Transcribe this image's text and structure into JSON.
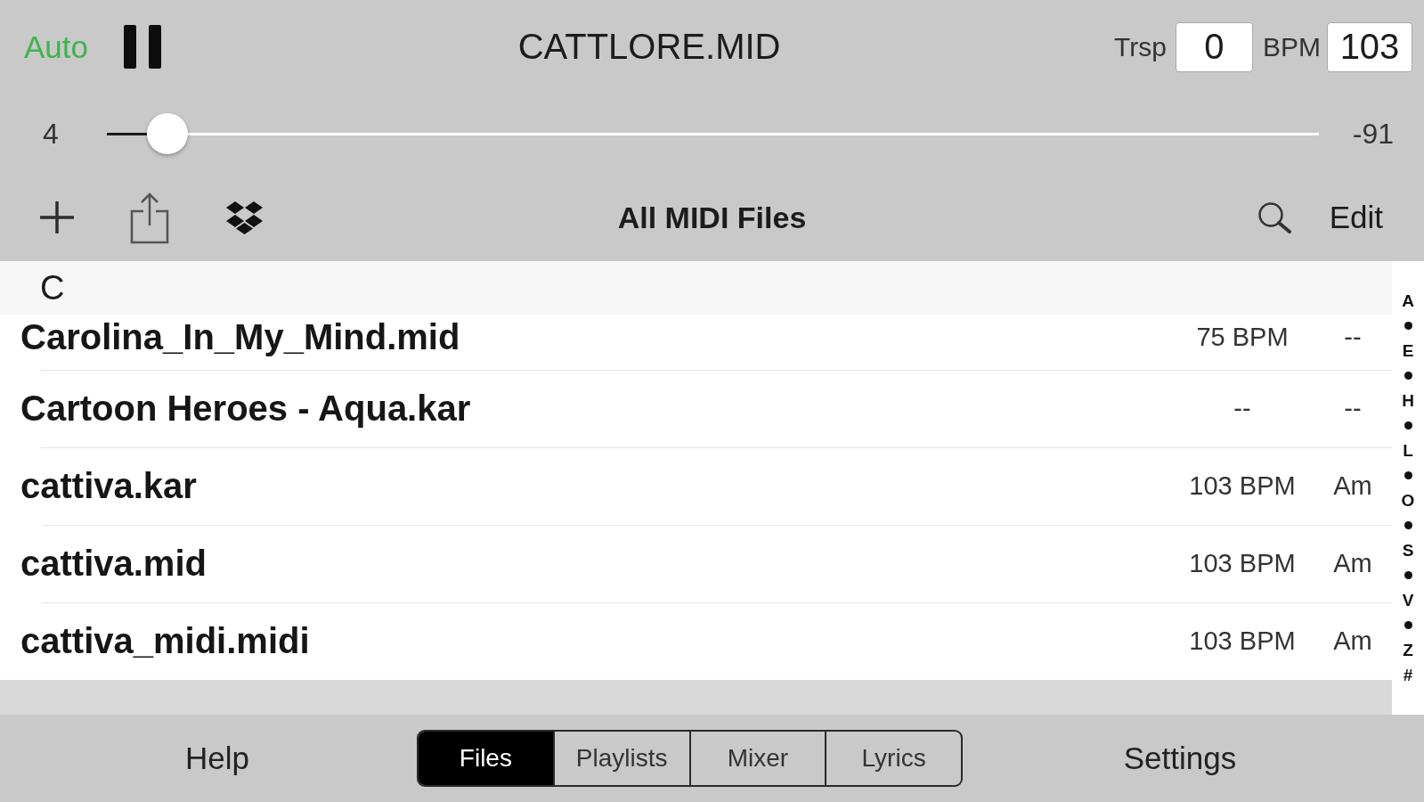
{
  "player": {
    "auto_button": "Auto",
    "title": "CATTLORE.MID",
    "transpose": {
      "label": "Trsp",
      "value": "0"
    },
    "tempo": {
      "label": "BPM",
      "value": "103"
    }
  },
  "position": {
    "elapsed": "4",
    "remaining": "-91",
    "level": 0.05
  },
  "toolbar": {
    "title": "All MIDI Files",
    "edit_button": "Edit"
  },
  "file_list": {
    "section": "C",
    "rows": [
      {
        "name": "Carolina_In_My_Mind.mid",
        "tempo": "75 BPM",
        "key": "--",
        "selected": false
      },
      {
        "name": "Cartoon Heroes - Aqua.kar",
        "tempo": "--",
        "key": "--",
        "selected": false
      },
      {
        "name": "cattiva.kar",
        "tempo": "103 BPM",
        "key": "Am",
        "selected": false
      },
      {
        "name": "cattiva.mid",
        "tempo": "103 BPM",
        "key": "Am",
        "selected": false
      },
      {
        "name": "cattiva_midi.midi",
        "tempo": "103 BPM",
        "key": "Am",
        "selected": false
      },
      {
        "selected": true
      }
    ]
  },
  "index": [
    {
      "kind": "letter",
      "text": "A"
    },
    {
      "kind": "dot"
    },
    {
      "kind": "letter",
      "text": "E"
    },
    {
      "kind": "dot"
    },
    {
      "kind": "letter",
      "text": "H"
    },
    {
      "kind": "dot"
    },
    {
      "kind": "letter",
      "text": "L"
    },
    {
      "kind": "dot"
    },
    {
      "kind": "letter",
      "text": "O"
    },
    {
      "kind": "dot"
    },
    {
      "kind": "letter",
      "text": "S"
    },
    {
      "kind": "dot"
    },
    {
      "kind": "letter",
      "text": "V"
    },
    {
      "kind": "dot"
    },
    {
      "kind": "letter",
      "text": "Z"
    },
    {
      "kind": "letter",
      "text": "#"
    }
  ],
  "footer": {
    "help_button": "Help",
    "tabs": [
      {
        "label": "Files",
        "selected": true
      },
      {
        "label": "Playlists",
        "selected": false
      },
      {
        "label": "Mixer",
        "selected": false
      },
      {
        "label": "Lyrics",
        "selected": false
      }
    ],
    "settings_button": "Settings"
  }
}
